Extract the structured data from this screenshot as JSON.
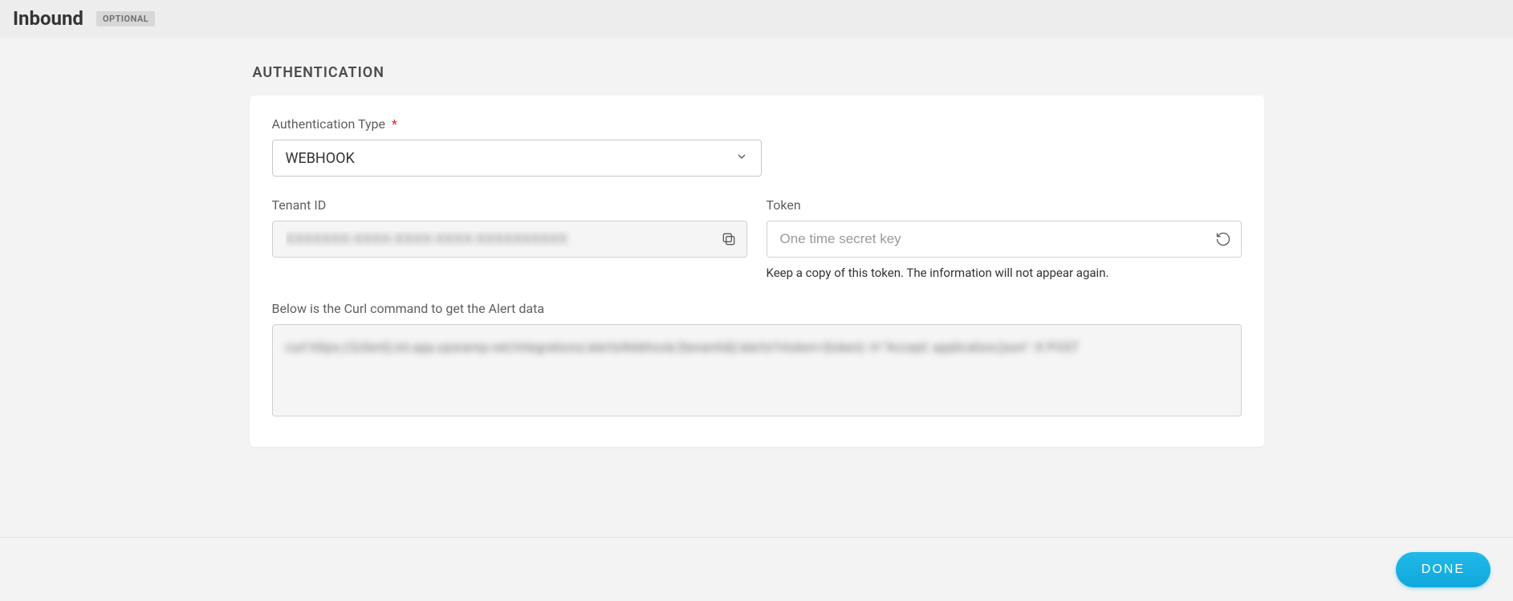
{
  "header": {
    "title": "Inbound",
    "badge": "OPTIONAL"
  },
  "auth": {
    "sectionTitle": "AUTHENTICATION",
    "typeLabel": "Authentication Type",
    "required": "*",
    "typeValue": "WEBHOOK",
    "tenantLabel": "Tenant ID",
    "tenantValue": "XXXXXXX-XXXX-XXXX-XXXX-XXXXXXXXXX",
    "tokenLabel": "Token",
    "tokenPlaceholder": "One time secret key",
    "tokenHelp": "Keep a copy of this token. The information will not appear again.",
    "curlLabel": "Below is the Curl command to get the Alert data",
    "curlValue": "curl https://{client}.int.app.opsramp.net/integrations/alertsWebhook/{tenantId}/alerts?vtoken={token} -H \"Accept: application/json\" -X POST"
  },
  "footer": {
    "done": "DONE"
  }
}
